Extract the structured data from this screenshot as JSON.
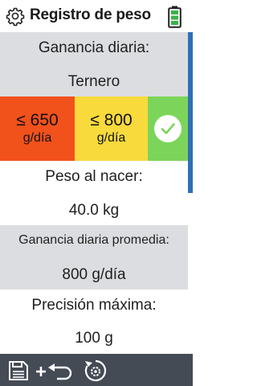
{
  "header": {
    "title": "Registro de peso",
    "settings_icon": "gear-icon",
    "battery_icon": "battery-icon",
    "battery_color": "#37b34a"
  },
  "daily_gain": {
    "label": "Ganancia diaria:",
    "category": "Ternero",
    "options": [
      {
        "main": "≤ 650",
        "unit": "g/día",
        "color": "#f1511b"
      },
      {
        "main": "≤ 800",
        "unit": "g/día",
        "color": "#f8da3c"
      },
      {
        "icon": "check-icon",
        "color": "#7cd55a",
        "selected": true
      }
    ]
  },
  "birth_weight": {
    "label": "Peso al nacer:",
    "value": "40.0 kg"
  },
  "avg_daily_gain": {
    "label": "Ganancia diaria promedia:",
    "value": "800 g/día"
  },
  "max_precision": {
    "label": "Precisión máxima:",
    "value": "100 g"
  },
  "footer": {
    "background": "#454b55",
    "icons": [
      "save-icon",
      "plus-return-icon",
      "reset-settings-icon"
    ]
  },
  "colors": {
    "gray_section": "#dcdde0",
    "scroll_accent": "#2f6fb5"
  }
}
